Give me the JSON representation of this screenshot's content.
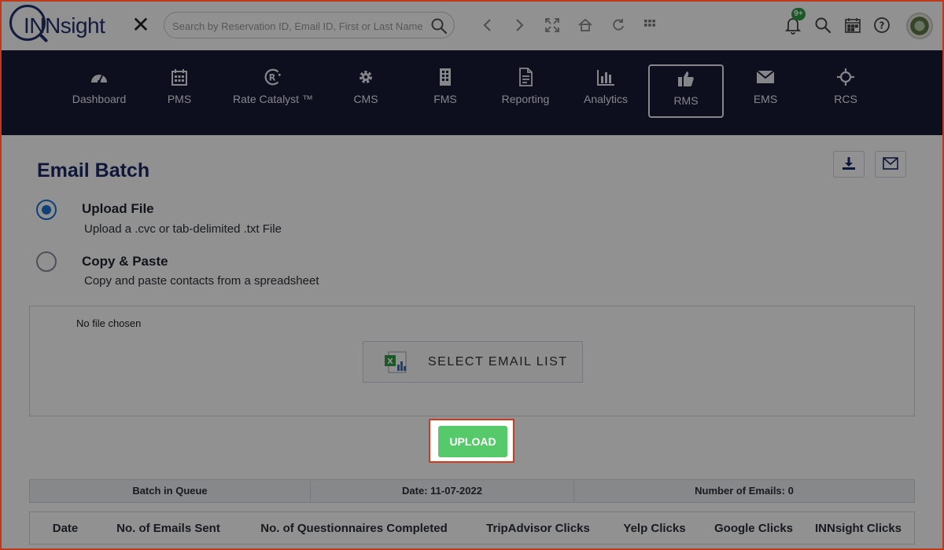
{
  "header": {
    "logo_text": "INNsight",
    "close_symbol": "✕",
    "search_placeholder": "Search by Reservation ID, Email ID, First or Last Name",
    "notification_badge": "9+",
    "toolbar_icons": [
      "chevron-left-icon",
      "chevron-right-icon",
      "expand-icon",
      "home-icon",
      "refresh-icon",
      "grid-icon",
      "bell-icon",
      "search-icon",
      "calendar-icon",
      "help-icon"
    ]
  },
  "nav": {
    "items": [
      {
        "label": "Dashboard",
        "icon": "speedometer-icon"
      },
      {
        "label": "PMS",
        "icon": "calendar-grid-icon"
      },
      {
        "label": "Rate Catalyst ™",
        "icon": "rate-catalyst-icon"
      },
      {
        "label": "CMS",
        "icon": "gear-icon"
      },
      {
        "label": "FMS",
        "icon": "building-icon"
      },
      {
        "label": "Reporting",
        "icon": "document-icon"
      },
      {
        "label": "Analytics",
        "icon": "bar-chart-icon"
      },
      {
        "label": "RMS",
        "icon": "thumbs-up-icon",
        "active": true
      },
      {
        "label": "EMS",
        "icon": "envelope-icon"
      },
      {
        "label": "RCS",
        "icon": "crosshair-icon"
      }
    ]
  },
  "page": {
    "title": "Email Batch",
    "options": [
      {
        "label": "Upload File",
        "description": "Upload a .cvc or tab-delimited .txt File",
        "checked": true
      },
      {
        "label": "Copy & Paste",
        "description": "Copy and paste contacts from a spreadsheet",
        "checked": false
      }
    ],
    "file_status": "No file chosen",
    "select_button_label": "SELECT EMAIL LIST",
    "upload_button_label": "UPLOAD"
  },
  "batch": {
    "queue_label": "Batch in Queue",
    "date_label": "Date: 11-07-2022",
    "count_label": "Number of Emails: 0"
  },
  "table": {
    "columns": [
      "Date",
      "No. of Emails Sent",
      "No. of Questionnaires Completed",
      "TripAdvisor Clicks",
      "Yelp Clicks",
      "Google Clicks",
      "INNsight Clicks"
    ]
  },
  "colors": {
    "nav_bg": "#171b38",
    "brand": "#23306e",
    "title": "#1b2a66",
    "upload_green": "#56c96a",
    "highlight": "#d2391d",
    "radio_accent": "#1a72d4",
    "badge_green": "#2e9c46"
  }
}
